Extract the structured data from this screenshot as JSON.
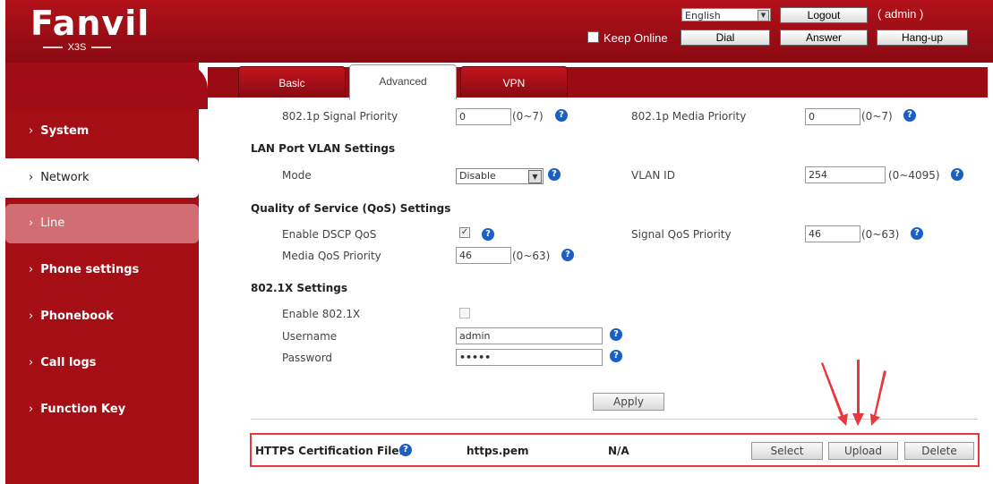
{
  "header": {
    "logo": "Fanvil",
    "model": "X3S",
    "language": "English",
    "logout_label": "Logout",
    "user": "( admin )",
    "keep_online_label": "Keep Online",
    "dial_label": "Dial",
    "answer_label": "Answer",
    "hangup_label": "Hang-up"
  },
  "sidebar": {
    "items": [
      {
        "label": "System"
      },
      {
        "label": "Network"
      },
      {
        "label": "Line"
      },
      {
        "label": "Phone settings"
      },
      {
        "label": "Phonebook"
      },
      {
        "label": "Call logs"
      },
      {
        "label": "Function Key"
      }
    ],
    "chevron": "›"
  },
  "tabs": [
    {
      "label": "Basic"
    },
    {
      "label": "Advanced"
    },
    {
      "label": "VPN"
    }
  ],
  "signal": {
    "signal_priority_label": "802.1p Signal Priority",
    "signal_priority_value": "0",
    "signal_priority_range": "(0~7)",
    "media_priority_label": "802.1p Media Priority",
    "media_priority_value": "0",
    "media_priority_range": "(0~7)"
  },
  "lan_vlan": {
    "title": "LAN Port VLAN Settings",
    "mode_label": "Mode",
    "mode_value": "Disable",
    "vlan_id_label": "VLAN ID",
    "vlan_id_value": "254",
    "vlan_id_range": "(0~4095)"
  },
  "qos": {
    "title": "Quality of Service (QoS) Settings",
    "dscp_label": "Enable DSCP QoS",
    "dscp_checked": true,
    "signal_qos_label": "Signal QoS Priority",
    "signal_qos_value": "46",
    "signal_qos_range": "(0~63)",
    "media_qos_label": "Media QoS Priority",
    "media_qos_value": "46",
    "media_qos_range": "(0~63)"
  },
  "dot1x": {
    "title": "802.1X Settings",
    "enable_label": "Enable 802.1X",
    "enable_checked": false,
    "username_label": "Username",
    "username_value": "admin",
    "password_label": "Password",
    "password_value": "•••••"
  },
  "apply_label": "Apply",
  "https": {
    "label": "HTTPS Certification File:",
    "file": "https.pem",
    "status": "N/A",
    "select_label": "Select",
    "upload_label": "Upload",
    "delete_label": "Delete"
  },
  "help_glyph": "?",
  "check_glyph": "✓",
  "select_arrow": "▼",
  "colors": {
    "brand_red": "#a60e16",
    "help_blue": "#1a5fc4",
    "highlight": "#e8383d"
  }
}
